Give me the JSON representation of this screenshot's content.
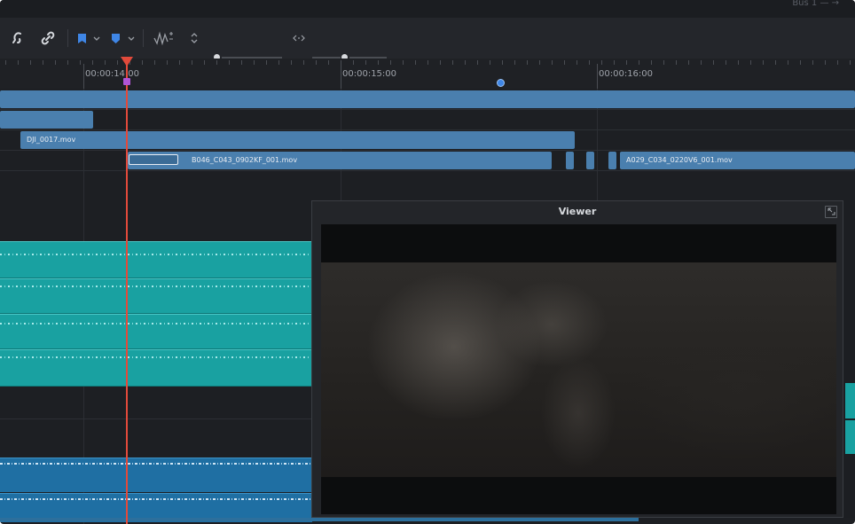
{
  "window": {
    "top_right_text": "Bus 1 — →"
  },
  "toolbar": {
    "items": [
      {
        "name": "snapping-icon",
        "glyph": "ċ"
      },
      {
        "name": "linked-selection-icon",
        "glyph": "∂"
      },
      {
        "name": "flag-icon",
        "glyph": "▮"
      },
      {
        "name": "flag-dropdown-icon",
        "glyph": "⌄"
      },
      {
        "name": "marker-icon",
        "glyph": "▮"
      },
      {
        "name": "marker-dropdown-icon",
        "glyph": "⌄"
      },
      {
        "name": "audio-waveform-icon",
        "glyph": "√√"
      },
      {
        "name": "track-height-icon",
        "glyph": "⇕"
      },
      {
        "name": "zoom-width-icon",
        "glyph": "<·>"
      }
    ],
    "accent": "#3f86e6"
  },
  "ruler": {
    "timecodes": [
      "00:00:14:00",
      "00:00:15:00",
      "00:00:16:00"
    ]
  },
  "clips": {
    "v3": "DJI_0017.mov",
    "v2a": "B046_C043_0902KF_001.mov",
    "v2b": "A029_C034_0220V6_001.mov"
  },
  "viewer": {
    "title": "Viewer"
  },
  "colors": {
    "playhead": "#e24a3b",
    "video_clip": "#4a7fae",
    "audio_clip": "#19a1a1",
    "audio_clip_2": "#1f6fa3"
  }
}
